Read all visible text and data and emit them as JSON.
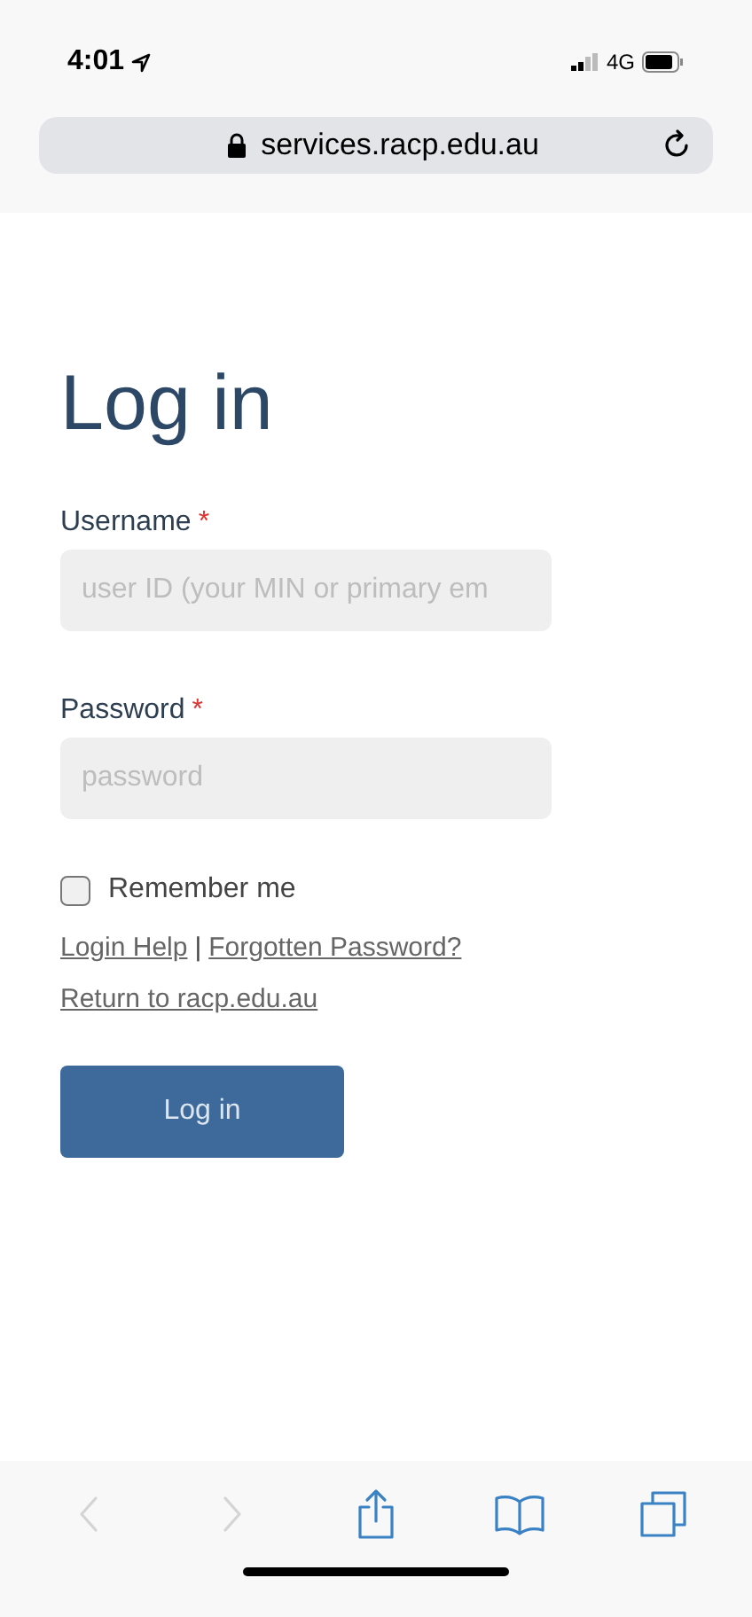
{
  "status_bar": {
    "time": "4:01",
    "network": "4G"
  },
  "address_bar": {
    "url": "services.racp.edu.au"
  },
  "heading": "Log in",
  "fields": [
    {
      "label": "Username",
      "required_mark": "*",
      "placeholder": "user ID (your MIN or primary em"
    },
    {
      "label": "Password",
      "required_mark": "*",
      "placeholder": "password"
    }
  ],
  "remember": {
    "label": "Remember me",
    "checked": false
  },
  "links": [
    {
      "label": "Login Help"
    },
    {
      "label": "Forgotten Password?"
    }
  ],
  "link_separator": "|",
  "return_link": "Return to racp.edu.au",
  "submit": "Log in",
  "toolbar": [
    {
      "kind": "back",
      "disabled": true
    },
    {
      "kind": "forward",
      "disabled": true
    },
    {
      "kind": "share",
      "disabled": false
    },
    {
      "kind": "bookmarks",
      "disabled": false
    },
    {
      "kind": "tabs",
      "disabled": false
    }
  ]
}
